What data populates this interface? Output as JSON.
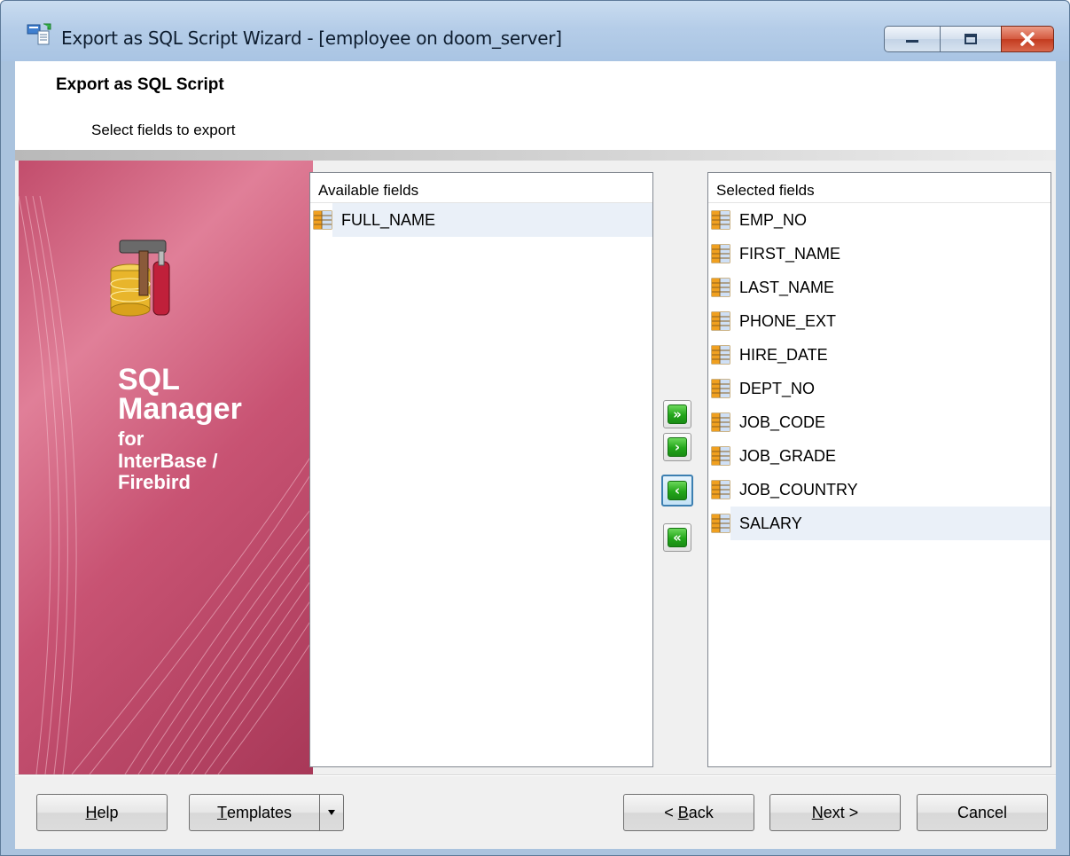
{
  "window": {
    "title": "Export as SQL Script Wizard - [employee on doom_server]",
    "controls": [
      "minimize",
      "maximize",
      "close"
    ]
  },
  "header": {
    "title": "Export as SQL Script",
    "subtitle": "Select fields to export"
  },
  "banner": {
    "line1": "SQL",
    "line2": "Manager",
    "line3": "for",
    "line4": "InterBase /",
    "line5": "Firebird"
  },
  "available": {
    "header": "Available fields",
    "items": [
      {
        "label": "FULL_NAME",
        "icon": "table-field-icon"
      }
    ]
  },
  "selected": {
    "header": "Selected fields",
    "items": [
      {
        "label": "EMP_NO"
      },
      {
        "label": "FIRST_NAME"
      },
      {
        "label": "LAST_NAME"
      },
      {
        "label": "PHONE_EXT"
      },
      {
        "label": "HIRE_DATE"
      },
      {
        "label": "DEPT_NO"
      },
      {
        "label": "JOB_CODE"
      },
      {
        "label": "JOB_GRADE"
      },
      {
        "label": "JOB_COUNTRY"
      },
      {
        "label": "SALARY"
      }
    ]
  },
  "move_buttons": {
    "add_all": "»",
    "add_one": "›",
    "remove_one": "‹",
    "remove_all": "«"
  },
  "buttons": {
    "help_pre": "",
    "help_ul": "H",
    "help_post": "elp",
    "templates_pre": "",
    "templates_ul": "T",
    "templates_post": "emplates",
    "back_pre": "< ",
    "back_ul": "B",
    "back_post": "ack",
    "next_pre": "",
    "next_ul": "N",
    "next_post": "ext >",
    "cancel": "Cancel"
  },
  "colors": {
    "banner": "#c85373",
    "arrow_green": "#23a61a",
    "titlebar": "#b5cde8"
  }
}
